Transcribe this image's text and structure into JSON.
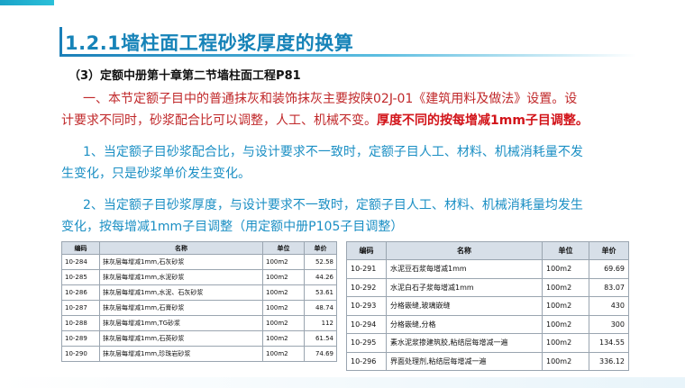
{
  "title": "1.2.1墙柱面工程砂浆厚度的换算",
  "subtitle": "（3）定额中册第十章第二节墙柱面工程P81",
  "para1": {
    "line1": "一、本节定额子目中的普通抹灰和装饰抹灰主要按陕02J-01《建筑用料及做法》设置。设",
    "line2_normal": "计要求不同时，砂浆配合比可以调整，人工、机械不变。",
    "line2_strong": "厚度不同的按每增减1mm子目调整。"
  },
  "para2": {
    "line1": "1、当定额子目砂浆配合比，与设计要求不一致时，定额子目人工、材料、机械消耗量不发",
    "line2": "生变化，只是砂浆单价发生变化。"
  },
  "para3": {
    "line1": "2、当定额子目砂浆厚度，与设计要求不一致时，定额子目人工、材料、机械消耗量均发生",
    "line2": "变化，按每增减1mm子目调整（用定额中册P105子目调整）"
  },
  "table_left": {
    "headers": [
      "编码",
      "名称",
      "单位",
      "单价"
    ],
    "rows": [
      [
        "10-284",
        "抹灰层每增减1mm,石灰砂浆",
        "100m2",
        "52.58"
      ],
      [
        "10-285",
        "抹灰层每增减1mm,水泥砂浆",
        "100m2",
        "44.26"
      ],
      [
        "10-286",
        "抹灰层每增减1mm,水泥、石灰砂浆",
        "100m2",
        "53.61"
      ],
      [
        "10-287",
        "抹灰层每增减1mm,石膏砂浆",
        "100m2",
        "48.74"
      ],
      [
        "10-288",
        "抹灰层每增减1mm,TG砂浆",
        "100m2",
        "112"
      ],
      [
        "10-289",
        "抹灰层每增减1mm,石英砂浆",
        "100m2",
        "61.54"
      ],
      [
        "10-290",
        "抹灰层每增减1mm,珍珠岩砂浆",
        "100m2",
        "74.69"
      ]
    ]
  },
  "table_right": {
    "headers": [
      "编码",
      "名称",
      "单位",
      "单价"
    ],
    "rows": [
      [
        "10-291",
        "水泥豆石浆每增减1mm",
        "100m2",
        "69.69"
      ],
      [
        "10-292",
        "水泥白石子浆每增减1mm",
        "100m2",
        "83.07"
      ],
      [
        "10-293",
        "分格嵌缝,玻璃嵌缝",
        "100m2",
        "430"
      ],
      [
        "10-294",
        "分格嵌缝,分格",
        "100m2",
        "300"
      ],
      [
        "10-295",
        "素水泥浆掺建筑胶,粘结层每增减一遍",
        "100m2",
        "134.55"
      ],
      [
        "10-296",
        "界面处理剂,粘结层每增减一遍",
        "100m2",
        "336.12"
      ]
    ]
  }
}
